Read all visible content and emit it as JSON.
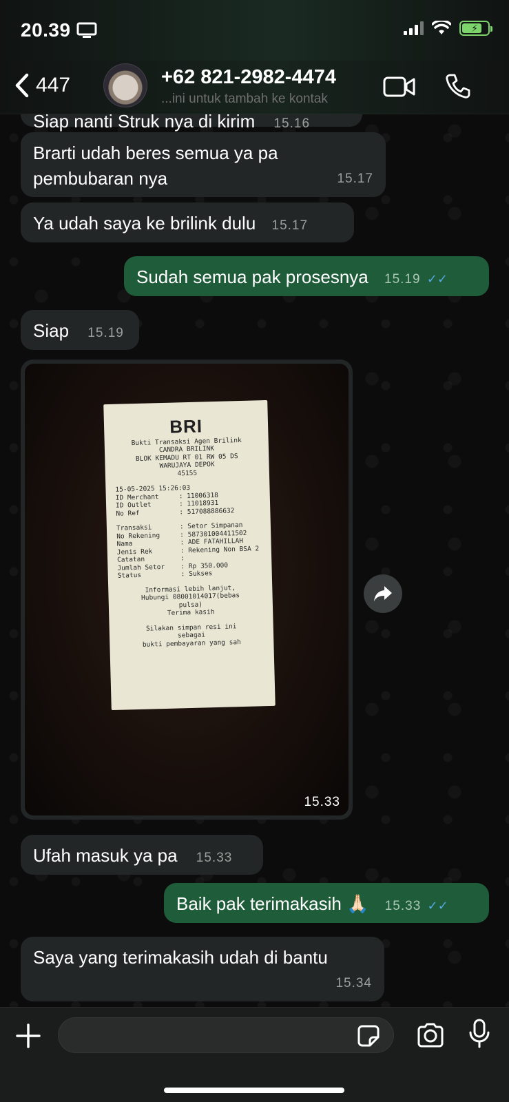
{
  "statusbar": {
    "time": "20.39"
  },
  "header": {
    "back_count": "447",
    "contact_name": "+62 821-2982-4474",
    "contact_sub": "...ini untuk tambah ke kontak"
  },
  "messages": [
    {
      "dir": "in",
      "text": "Siap nanti Struk nya di kirim",
      "time": "15.16"
    },
    {
      "dir": "in",
      "text": "Brarti udah beres semua ya pa pembubaran nya",
      "time": "15.17"
    },
    {
      "dir": "in",
      "text": "Ya udah saya ke brilink dulu",
      "time": "15.17"
    },
    {
      "dir": "out",
      "text": "Sudah semua pak prosesnya",
      "time": "15.19"
    },
    {
      "dir": "in",
      "text": "Siap",
      "time": "15.19"
    },
    {
      "dir": "in",
      "text": "Ufah masuk ya pa",
      "time": "15.33"
    },
    {
      "dir": "out",
      "text": "Baik pak terimakasih 🙏🏻",
      "time": "15.33"
    },
    {
      "dir": "in",
      "text": "Saya yang terimakasih udah di bantu",
      "time": "15.34"
    }
  ],
  "image_message": {
    "time": "15.33",
    "receipt": {
      "logo": "BRI",
      "head": [
        "Bukti Transaksi Agen Brilink",
        "CANDRA BRILINK",
        "BLOK KEMADU RT 01 RW 05 DS",
        "WARUJAYA DEPOK",
        "45155"
      ],
      "datetime": "15-05-2025 15:26:03",
      "rows1": [
        {
          "k": "ID Merchant",
          "v": ": 11006318"
        },
        {
          "k": "ID Outlet",
          "v": ": 11018931"
        },
        {
          "k": "No Ref",
          "v": ": 517088886632"
        }
      ],
      "rows2": [
        {
          "k": "Transaksi",
          "v": ": Setor Simpanan"
        },
        {
          "k": "No Rekening",
          "v": ": 587301004411502"
        },
        {
          "k": "Nama",
          "v": ": ADE FATAHILLAH"
        },
        {
          "k": "Jenis Rek",
          "v": ": Rekening Non BSA 2"
        },
        {
          "k": "Catatan",
          "v": ":"
        },
        {
          "k": "Jumlah Setor",
          "v": ": Rp 350.000"
        },
        {
          "k": "Status",
          "v": ": Sukses"
        }
      ],
      "foot": [
        "Informasi lebih lanjut,",
        "Hubungi 08001014017(bebas",
        "pulsa)",
        "Terima kasih"
      ],
      "foot2": [
        "Silakan simpan resi ini",
        "sebagai",
        "bukti pembayaran yang sah"
      ]
    }
  },
  "icons": [
    "video-icon",
    "phone-icon",
    "forward-icon",
    "plus-icon",
    "sticker-icon",
    "camera-icon",
    "mic-icon"
  ],
  "colors": {
    "incoming": "#232626",
    "outgoing": "#1f5c3a",
    "read_ticks": "#53a8e2"
  }
}
